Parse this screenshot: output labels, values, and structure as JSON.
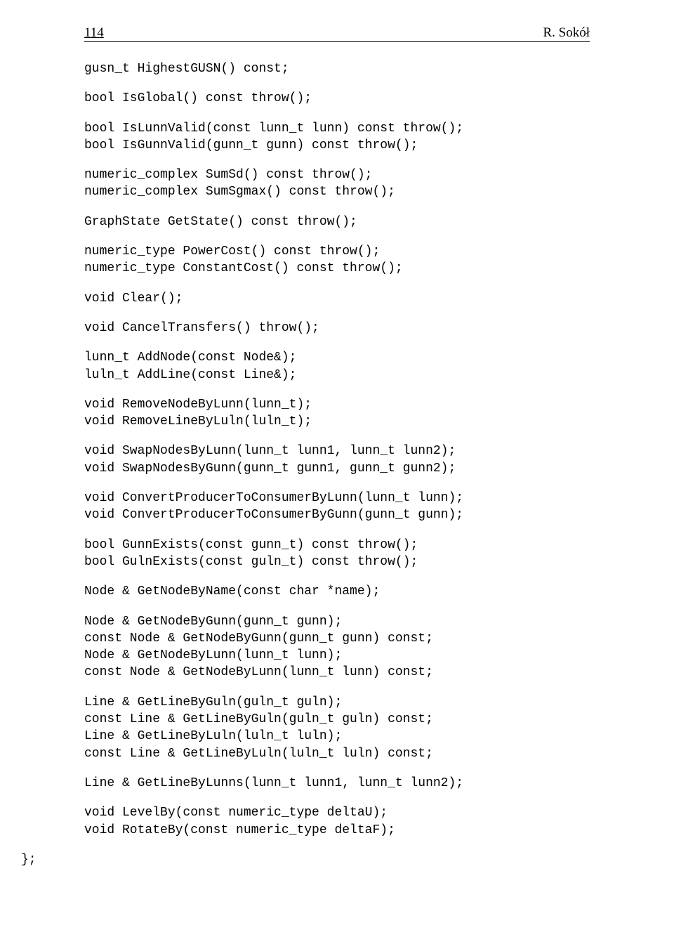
{
  "header": {
    "page_number": "114",
    "author": "R. Sokół"
  },
  "code": {
    "block1": "gusn_t HighestGUSN() const;",
    "block2": "bool IsGlobal() const throw();",
    "block3": "bool IsLunnValid(const lunn_t lunn) const throw();\nbool IsGunnValid(gunn_t gunn) const throw();",
    "block4": "numeric_complex SumSd() const throw();\nnumeric_complex SumSgmax() const throw();",
    "block5": "GraphState GetState() const throw();",
    "block6": "numeric_type PowerCost() const throw();\nnumeric_type ConstantCost() const throw();",
    "block7": "void Clear();",
    "block8": "void CancelTransfers() throw();",
    "block9": "lunn_t AddNode(const Node&);\nluln_t AddLine(const Line&);",
    "block10": "void RemoveNodeByLunn(lunn_t);\nvoid RemoveLineByLuln(luln_t);",
    "block11": "void SwapNodesByLunn(lunn_t lunn1, lunn_t lunn2);\nvoid SwapNodesByGunn(gunn_t gunn1, gunn_t gunn2);",
    "block12": "void ConvertProducerToConsumerByLunn(lunn_t lunn);\nvoid ConvertProducerToConsumerByGunn(gunn_t gunn);",
    "block13": "bool GunnExists(const gunn_t) const throw();\nbool GulnExists(const guln_t) const throw();",
    "block14": "Node & GetNodeByName(const char *name);",
    "block15": "Node & GetNodeByGunn(gunn_t gunn);\nconst Node & GetNodeByGunn(gunn_t gunn) const;\nNode & GetNodeByLunn(lunn_t lunn);\nconst Node & GetNodeByLunn(lunn_t lunn) const;",
    "block16": "Line & GetLineByGuln(guln_t guln);\nconst Line & GetLineByGuln(guln_t guln) const;\nLine & GetLineByLuln(luln_t luln);\nconst Line & GetLineByLuln(luln_t luln) const;",
    "block17": "Line & GetLineByLunns(lunn_t lunn1, lunn_t lunn2);",
    "block18": "void LevelBy(const numeric_type deltaU);\nvoid RotateBy(const numeric_type deltaF);",
    "closing": "};"
  }
}
